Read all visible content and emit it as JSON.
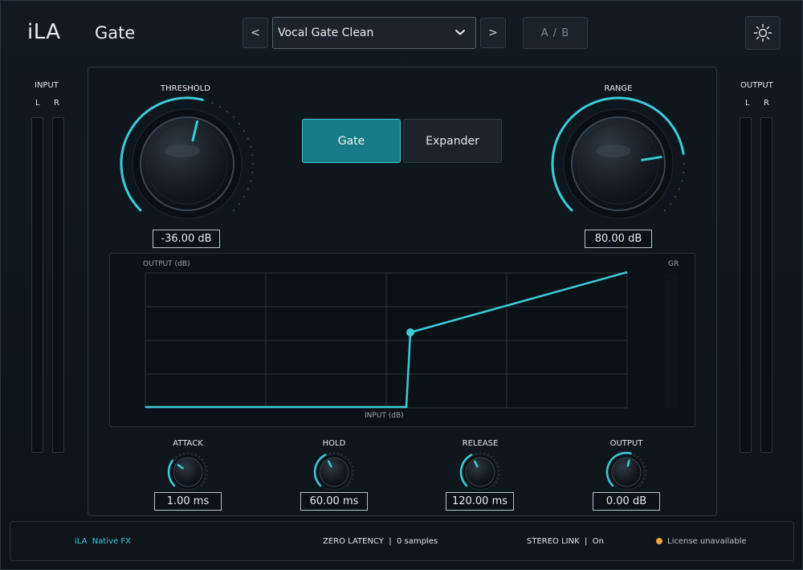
{
  "header": {
    "logo": "iLA",
    "plugin_name": "Gate",
    "prev_label": "<",
    "next_label": ">",
    "preset_name": "Vocal Gate Clean",
    "ab_label": "A / B"
  },
  "meters": {
    "input_title": "INPUT",
    "output_title": "OUTPUT",
    "left_label": "L",
    "right_label": "R"
  },
  "knobs": {
    "threshold": {
      "label": "THRESHOLD",
      "value": "-36.00 dB",
      "position": 0.55
    },
    "range": {
      "label": "RANGE",
      "value": "80.00 dB",
      "position": 0.8
    },
    "attack": {
      "label": "ATTACK",
      "value": "1.00 ms",
      "position": 0.3
    },
    "hold": {
      "label": "HOLD",
      "value": "60.00 ms",
      "position": 0.4
    },
    "release": {
      "label": "RELEASE",
      "value": "120.00 ms",
      "position": 0.4
    },
    "output": {
      "label": "OUTPUT",
      "value": "0.00 dB",
      "position": 0.55
    }
  },
  "modes": {
    "gate_label": "Gate",
    "expander_label": "Expander",
    "selected": "Gate"
  },
  "graph": {
    "output_label": "OUTPUT (dB)",
    "input_label": "INPUT (dB)",
    "gr_label": "GR"
  },
  "footer": {
    "brand": "iLA",
    "brand_sub": "Native FX",
    "latency_label": "ZERO LATENCY",
    "latency_sep": "|",
    "latency_value": "0 samples",
    "stereo_label": "STEREO LINK",
    "stereo_sep": "|",
    "stereo_value": "On",
    "license_status": "License unavailable"
  },
  "colors": {
    "accent": "#3ccbd8",
    "active_button": "#167b86",
    "license_dot": "#f2a33a"
  }
}
